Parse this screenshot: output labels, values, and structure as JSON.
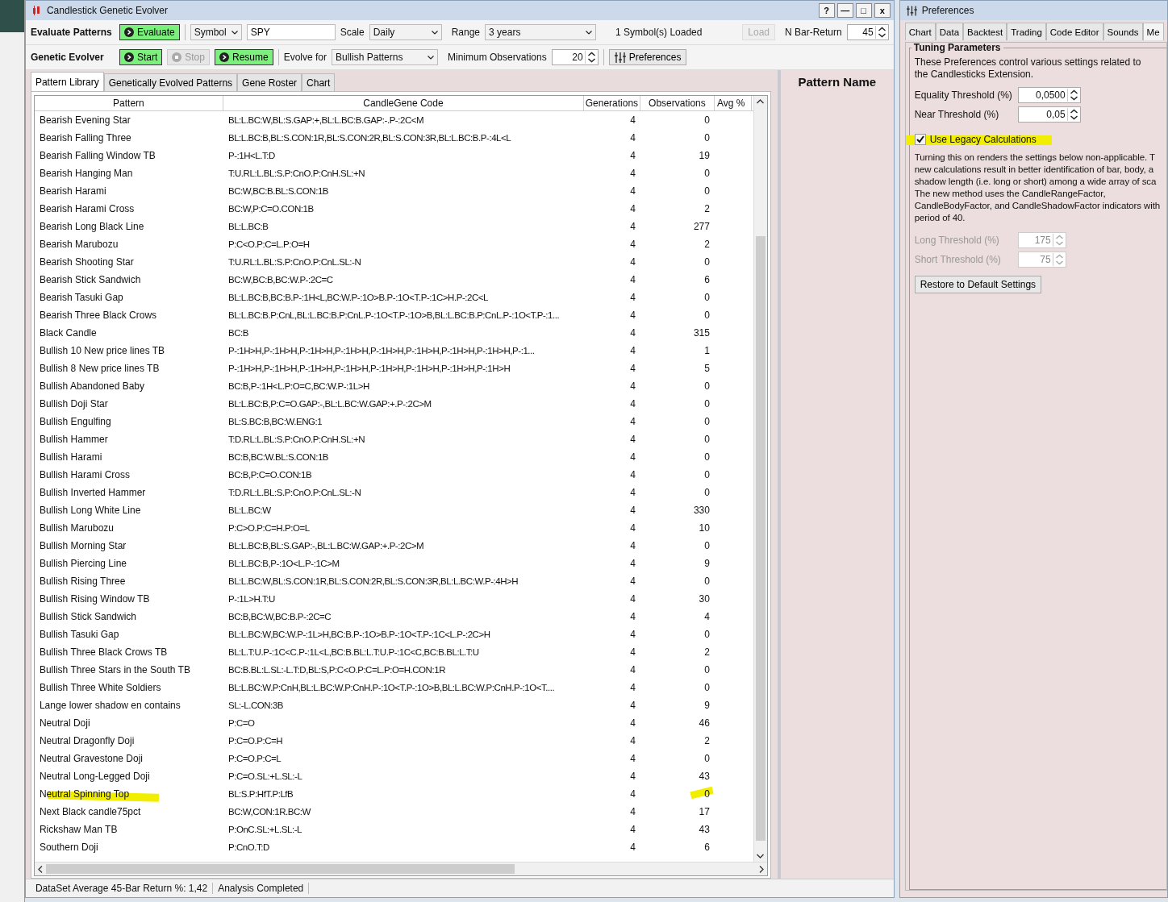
{
  "window": {
    "title": "Candlestick Genetic Evolver",
    "controls": [
      "?",
      "—",
      "□",
      "x"
    ]
  },
  "evaluate_bar": {
    "label": "Evaluate Patterns",
    "evaluate_button": "Evaluate",
    "symbol_select": "Symbol",
    "symbol_value": "SPY",
    "scale_label": "Scale",
    "scale_select": "Daily",
    "range_label": "Range",
    "range_select": "3 years",
    "loaded_status": "1 Symbol(s) Loaded",
    "load_button": {
      "label": "Load",
      "disabled": true
    },
    "nbar_label": "N Bar-Return",
    "nbar_value": "45"
  },
  "evolver_bar": {
    "label": "Genetic Evolver",
    "start_button": {
      "label": "Start",
      "disabled": false
    },
    "stop_button": {
      "label": "Stop",
      "disabled": true
    },
    "resume_button": {
      "label": "Resume",
      "disabled": false
    },
    "evolve_label": "Evolve for",
    "evolve_select": "Bullish Patterns",
    "min_obs_label": "Minimum Observations",
    "min_obs_value": "20",
    "preferences_button": "Preferences"
  },
  "tabs": [
    {
      "label": "Pattern Library",
      "selected": true
    },
    {
      "label": "Genetically Evolved Patterns",
      "selected": false
    },
    {
      "label": "Gene Roster",
      "selected": false
    },
    {
      "label": "Chart",
      "selected": false
    }
  ],
  "table": {
    "columns": [
      "Pattern",
      "CandleGene Code",
      "Generations",
      "Observations",
      "Avg %"
    ],
    "rows": [
      {
        "pattern": "Bearish Evening Star",
        "code": "BL:L.BC:W,BL:S.GAP:+,BL:L.BC:B.GAP:-.P-:2C<M",
        "generations": "4",
        "observations": "0",
        "highlighted": false
      },
      {
        "pattern": "Bearish Falling Three",
        "code": "BL:L.BC:B,BL:S.CON:1R,BL:S.CON:2R,BL:S.CON:3R,BL:L.BC:B.P-:4L<L",
        "generations": "4",
        "observations": "0",
        "highlighted": false
      },
      {
        "pattern": "Bearish Falling Window TB",
        "code": "P-:1H<L.T:D",
        "generations": "4",
        "observations": "19",
        "highlighted": false
      },
      {
        "pattern": "Bearish Hanging Man",
        "code": "T:U.RL:L.BL:S.P:CnO.P:CnH.SL:+N",
        "generations": "4",
        "observations": "0",
        "highlighted": false
      },
      {
        "pattern": "Bearish Harami",
        "code": "BC:W,BC:B.BL:S.CON:1B",
        "generations": "4",
        "observations": "0",
        "highlighted": false
      },
      {
        "pattern": "Bearish Harami Cross",
        "code": "BC:W,P:C=O.CON:1B",
        "generations": "4",
        "observations": "2",
        "highlighted": false
      },
      {
        "pattern": "Bearish Long Black Line",
        "code": "BL:L.BC:B",
        "generations": "4",
        "observations": "277",
        "highlighted": false
      },
      {
        "pattern": "Bearish Marubozu",
        "code": "P:C<O.P:C=L.P:O=H",
        "generations": "4",
        "observations": "2",
        "highlighted": false
      },
      {
        "pattern": "Bearish Shooting Star",
        "code": "T:U.RL:L.BL:S.P:CnO.P:CnL.SL:-N",
        "generations": "4",
        "observations": "0",
        "highlighted": false
      },
      {
        "pattern": "Bearish Stick Sandwich",
        "code": "BC:W,BC:B,BC:W.P-:2C=C",
        "generations": "4",
        "observations": "6",
        "highlighted": false
      },
      {
        "pattern": "Bearish Tasuki Gap",
        "code": "BL:L.BC:B,BC:B.P-:1H<L,BC:W.P-:1O>B.P-:1O<T.P-:1C>H.P-:2C<L",
        "generations": "4",
        "observations": "0",
        "highlighted": false
      },
      {
        "pattern": "Bearish Three Black Crows",
        "code": "BL:L.BC:B.P:CnL,BL:L.BC:B.P:CnL.P-:1O<T.P-:1O>B,BL:L.BC:B.P:CnL.P-:1O<T.P-:1...",
        "generations": "4",
        "observations": "0",
        "highlighted": false
      },
      {
        "pattern": "Black Candle",
        "code": "BC:B",
        "generations": "4",
        "observations": "315",
        "highlighted": false
      },
      {
        "pattern": "Bullish 10 New price lines TB",
        "code": "P-:1H>H,P-:1H>H,P-:1H>H,P-:1H>H,P-:1H>H,P-:1H>H,P-:1H>H,P-:1H>H,P-:1...",
        "generations": "4",
        "observations": "1",
        "highlighted": false
      },
      {
        "pattern": "Bullish 8 New price lines TB",
        "code": "P-:1H>H,P-:1H>H,P-:1H>H,P-:1H>H,P-:1H>H,P-:1H>H,P-:1H>H,P-:1H>H",
        "generations": "4",
        "observations": "5",
        "highlighted": false
      },
      {
        "pattern": "Bullish Abandoned Baby",
        "code": "BC:B,P-:1H<L.P:O=C,BC:W.P-:1L>H",
        "generations": "4",
        "observations": "0",
        "highlighted": false
      },
      {
        "pattern": "Bullish Doji Star",
        "code": "BL:L.BC:B,P:C=O.GAP:-,BL:L.BC:W.GAP:+.P-:2C>M",
        "generations": "4",
        "observations": "0",
        "highlighted": false
      },
      {
        "pattern": "Bullish Engulfing",
        "code": "BL:S.BC:B,BC:W.ENG:1",
        "generations": "4",
        "observations": "0",
        "highlighted": false
      },
      {
        "pattern": "Bullish Hammer",
        "code": "T:D.RL:L.BL:S.P:CnO.P:CnH.SL:+N",
        "generations": "4",
        "observations": "0",
        "highlighted": false
      },
      {
        "pattern": "Bullish Harami",
        "code": "BC:B,BC:W.BL:S.CON:1B",
        "generations": "4",
        "observations": "0",
        "highlighted": false
      },
      {
        "pattern": "Bullish Harami Cross",
        "code": "BC:B,P:C=O.CON:1B",
        "generations": "4",
        "observations": "0",
        "highlighted": false
      },
      {
        "pattern": "Bullish Inverted Hammer",
        "code": "T:D.RL:L.BL:S.P:CnO.P:CnL.SL:-N",
        "generations": "4",
        "observations": "0",
        "highlighted": false
      },
      {
        "pattern": "Bullish Long White Line",
        "code": "BL:L.BC:W",
        "generations": "4",
        "observations": "330",
        "highlighted": false
      },
      {
        "pattern": "Bullish Marubozu",
        "code": "P:C>O.P:C=H.P:O=L",
        "generations": "4",
        "observations": "10",
        "highlighted": false
      },
      {
        "pattern": "Bullish Morning Star",
        "code": "BL:L.BC:B,BL:S.GAP:-,BL:L.BC:W.GAP:+.P-:2C>M",
        "generations": "4",
        "observations": "0",
        "highlighted": false
      },
      {
        "pattern": "Bullish Piercing Line",
        "code": "BL:L.BC:B,P-:1O<L.P-:1C>M",
        "generations": "4",
        "observations": "9",
        "highlighted": false
      },
      {
        "pattern": "Bullish Rising Three",
        "code": "BL:L.BC:W,BL:S.CON:1R,BL:S.CON:2R,BL:S.CON:3R,BL:L.BC:W.P-:4H>H",
        "generations": "4",
        "observations": "0",
        "highlighted": false
      },
      {
        "pattern": "Bullish Rising Window TB",
        "code": "P-:1L>H.T:U",
        "generations": "4",
        "observations": "30",
        "highlighted": false
      },
      {
        "pattern": "Bullish Stick Sandwich",
        "code": "BC:B,BC:W,BC:B.P-:2C=C",
        "generations": "4",
        "observations": "4",
        "highlighted": false
      },
      {
        "pattern": "Bullish Tasuki Gap",
        "code": "BL:L.BC:W,BC:W.P-:1L>H,BC:B.P-:1O>B.P-:1O<T.P-:1C<L.P-:2C>H",
        "generations": "4",
        "observations": "0",
        "highlighted": false
      },
      {
        "pattern": "Bullish Three Black Crows TB",
        "code": "BL:L.T:U.P-:1C<C.P-:1L<L,BC:B.BL:L.T:U.P-:1C<C,BC:B.BL:L.T:U",
        "generations": "4",
        "observations": "2",
        "highlighted": false
      },
      {
        "pattern": "Bullish Three Stars in the South TB",
        "code": "BC:B.BL:L.SL:-L.T:D,BL:S,P:C<O.P:C=L.P:O=H.CON:1R",
        "generations": "4",
        "observations": "0",
        "highlighted": false
      },
      {
        "pattern": "Bullish Three White Soldiers",
        "code": "BL:L.BC:W.P:CnH,BL:L.BC:W.P:CnH.P-:1O<T.P-:1O>B,BL:L.BC:W.P:CnH.P-:1O<T....",
        "generations": "4",
        "observations": "0",
        "highlighted": false
      },
      {
        "pattern": "Lange lower shadow en contains",
        "code": "SL:-L.CON:3B",
        "generations": "4",
        "observations": "9",
        "highlighted": false
      },
      {
        "pattern": "Neutral Doji",
        "code": "P:C=O",
        "generations": "4",
        "observations": "46",
        "highlighted": false
      },
      {
        "pattern": "Neutral Dragonfly Doji",
        "code": "P:C=O.P:C=H",
        "generations": "4",
        "observations": "2",
        "highlighted": false
      },
      {
        "pattern": "Neutral Gravestone Doji",
        "code": "P:C=O.P:C=L",
        "generations": "4",
        "observations": "0",
        "highlighted": false
      },
      {
        "pattern": "Neutral Long-Legged Doji",
        "code": "P:C=O.SL:+L.SL:-L",
        "generations": "4",
        "observations": "43",
        "highlighted": false
      },
      {
        "pattern": "Neutral Spinning Top",
        "code": "BL:S.P:HfT.P:LfB",
        "generations": "4",
        "observations": "0",
        "highlighted": true
      },
      {
        "pattern": "Next Black candle75pct",
        "code": "BC:W,CON:1R.BC:W",
        "generations": "4",
        "observations": "17",
        "highlighted": false
      },
      {
        "pattern": "Rickshaw Man TB",
        "code": "P:OnC.SL:+L.SL:-L",
        "generations": "4",
        "observations": "43",
        "highlighted": false
      },
      {
        "pattern": "Southern Doji",
        "code": "P:CnO.T:D",
        "generations": "4",
        "observations": "6",
        "highlighted": false
      }
    ]
  },
  "side_panel": {
    "title": "Pattern Name"
  },
  "status_bar": [
    "DataSet Average 45-Bar Return %: 1,42",
    "Analysis Completed"
  ],
  "preferences": {
    "title": "Preferences",
    "tabs": [
      {
        "label": "Chart",
        "selected": false
      },
      {
        "label": "Data",
        "selected": false
      },
      {
        "label": "Backtest",
        "selected": false
      },
      {
        "label": "Trading",
        "selected": false
      },
      {
        "label": "Code Editor",
        "selected": false
      },
      {
        "label": "Sounds",
        "selected": false
      },
      {
        "label": "Me",
        "selected": true
      }
    ],
    "group_title": "Tuning Parameters",
    "intro": "These Preferences control various settings related to the Candlesticks Extension.",
    "fields": [
      {
        "label": "Equality Threshold (%)",
        "value": "0,0500",
        "disabled": false
      },
      {
        "label": "Near Threshold (%)",
        "value": "0,05",
        "disabled": false
      }
    ],
    "legacy_checkbox": {
      "label": "Use Legacy Calculations",
      "checked": true,
      "highlighted": true
    },
    "note_lines": [
      "Turning this on renders the settings below non-applicable. T",
      "new calculations result in better identification of bar, body, a",
      "shadow length (i.e. long or short) among a wide array of sca",
      "The new method uses the CandleRangeFactor,",
      "CandleBodyFactor, and CandleShadowFactor indicators with",
      "period of 40."
    ],
    "legacy_fields": [
      {
        "label": "Long Threshold (%)",
        "value": "175",
        "disabled": true
      },
      {
        "label": "Short Threshold (%)",
        "value": "75",
        "disabled": true
      }
    ],
    "restore_button": "Restore to Default Settings"
  }
}
